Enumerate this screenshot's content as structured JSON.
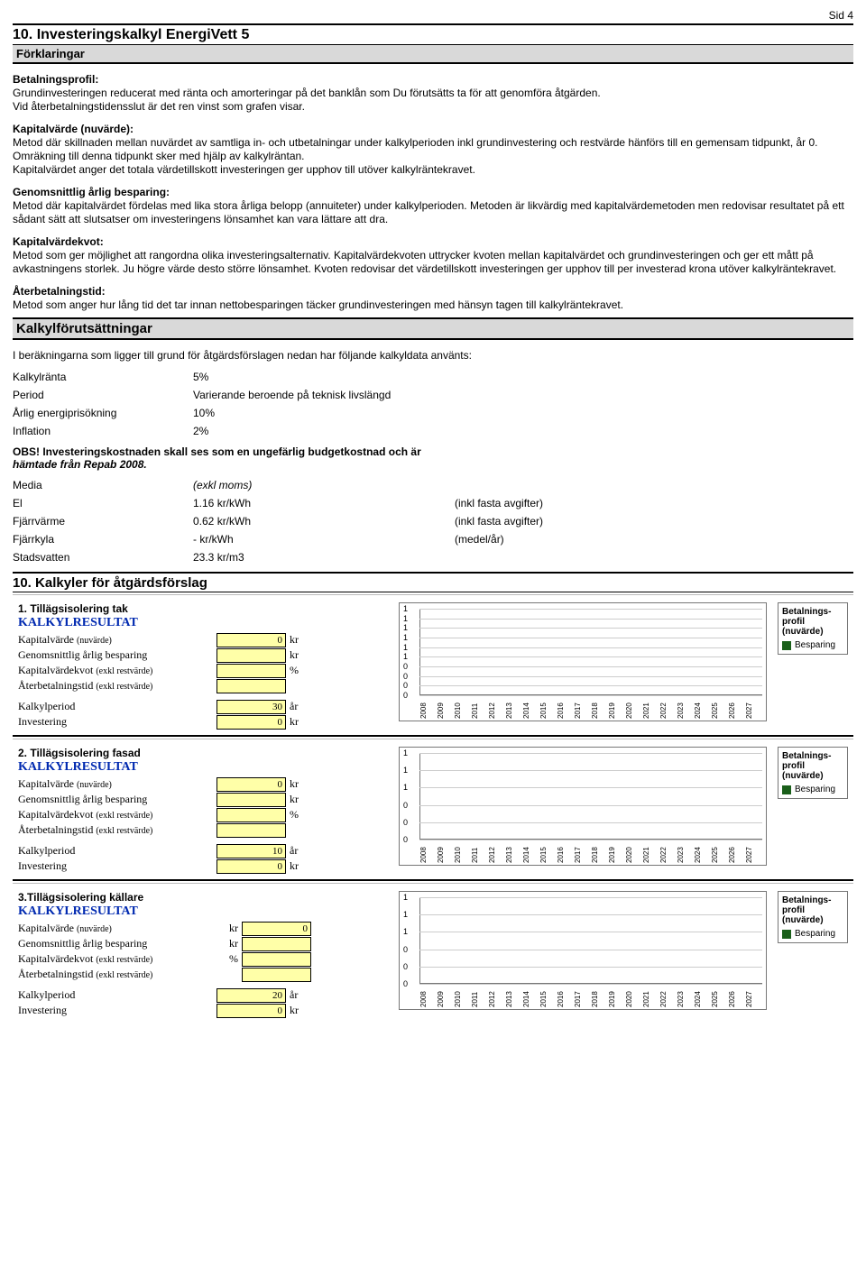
{
  "page_number": "Sid 4",
  "headline": "10. Investeringskalkyl EnergiVett 5",
  "subhead": "Förklaringar",
  "paragraphs": {
    "betalnings_title": "Betalningsprofil:",
    "betalnings_body1": "Grundinvesteringen reducerat med ränta och amorteringar på det banklån som Du förutsätts ta för att genomföra åtgärden.",
    "betalnings_body2": "Vid återbetalningstidensslut är det ren vinst som grafen visar.",
    "kapital_title": "Kapitalvärde (nuvärde):",
    "kapital_body1": "Metod där skillnaden mellan nuvärdet av samtliga in- och utbetalningar under kalkylperioden inkl grundinvestering och restvärde hänförs till en gemensam tidpunkt, år 0. Omräkning till denna tidpunkt sker med hjälp av kalkylräntan.",
    "kapital_body2": "Kapitalvärdet anger det totala värdetillskott investeringen ger upphov till utöver kalkylräntekravet.",
    "genoms_title": "Genomsnittlig årlig besparing:",
    "genoms_body": "Metod där kapitalvärdet fördelas med lika stora årliga belopp (annuiteter) under kalkylperioden. Metoden är likvärdig med kapitalvärdemetoden men redovisar resultatet på ett sådant sätt att slutsatser om investeringens lönsamhet kan vara lättare att dra.",
    "kvot_title": "Kapitalvärdekvot:",
    "kvot_body": "Metod som ger möjlighet att rangordna olika investeringsalternativ. Kapitalvärdekvoten uttrycker kvoten mellan kapitalvärdet och grundinvesteringen och ger ett mått på avkastningens storlek. Ju högre värde desto större lönsamhet. Kvoten redovisar det värdetillskott investeringen ger upphov till per investerad krona utöver kalkylräntekravet.",
    "aterb_title": "Återbetalningstid:",
    "aterb_body": "Metod som anger hur lång tid det tar innan nettobesparingen täcker grundinvesteringen med hänsyn tagen till kalkylräntekravet."
  },
  "kalkforut_title": "Kalkylförutsättningar",
  "kalkforut_intro": "I beräkningarna som ligger till grund för åtgärdsförslagen nedan har följande kalkyldata använts:",
  "kvrows": {
    "kalkylranta_k": "Kalkylränta",
    "kalkylranta_v": "5%",
    "period_k": "Period",
    "period_v": "Varierande beroende på teknisk livslängd",
    "arlig_k": "Årlig energiprisökning",
    "arlig_v": "10%",
    "inflation_k": "Inflation",
    "inflation_v": "2%",
    "obs1": "OBS! Investeringskostnaden skall ses som en ungefärlig budgetkostnad och är",
    "obs2": "hämtade från Repab 2008.",
    "media_k": "Media",
    "media_v": "(exkl moms)",
    "el_k": "El",
    "el_v": "1.16 kr/kWh",
    "el_n": "(inkl fasta avgifter)",
    "fj_k": "Fjärrvärme",
    "fj_v": "0.62 kr/kWh",
    "fj_n": "(inkl fasta avgifter)",
    "fk_k": "Fjärrkyla",
    "fk_v": "-  kr/kWh",
    "fk_n": "(medel/år)",
    "sv_k": "Stadsvatten",
    "sv_v": "23.3 kr/m3"
  },
  "section10_title": "10. Kalkyler för åtgärdsförslag",
  "legend_title": "Betalnings-profil (nuvärde)",
  "legend_item": "Besparing",
  "xyears": [
    "2008",
    "2009",
    "2010",
    "2011",
    "2012",
    "2013",
    "2014",
    "2015",
    "2016",
    "2017",
    "2018",
    "2019",
    "2020",
    "2021",
    "2022",
    "2023",
    "2024",
    "2025",
    "2026",
    "2027"
  ],
  "cards": [
    {
      "title": "1. Tillägsisolering tak",
      "heading": "KALKYLRESULTAT",
      "kapital_lbl": "Kapitalvärde",
      "kapital_sub": "(nuvärde)",
      "kapital_val": "0",
      "kapital_unit": "kr",
      "genoms_lbl": "Genomsnittlig årlig besparing",
      "genoms_val": "",
      "genoms_unit": "kr",
      "kvot_lbl": "Kapitalvärdekvot",
      "kvot_sub": "(exkl restvärde)",
      "kvot_val": "",
      "kvot_unit": "%",
      "ater_lbl": "Återbetalningstid",
      "ater_sub": "(exkl restvärde)",
      "ater_val": "",
      "period_lbl": "Kalkylperiod",
      "period_val": "30",
      "period_unit": "år",
      "invest_lbl": "Investering",
      "invest_val": "0",
      "invest_unit": "kr",
      "yticks": [
        "1",
        "1",
        "1",
        "1",
        "1",
        "1",
        "0",
        "0",
        "0",
        "0"
      ]
    },
    {
      "title": "2. Tillägsisolering fasad",
      "heading": "KALKYLRESULTAT",
      "kapital_lbl": "Kapitalvärde",
      "kapital_sub": "(nuvärde)",
      "kapital_val": "0",
      "kapital_unit": "kr",
      "genoms_lbl": "Genomsnittlig årlig besparing",
      "genoms_val": "",
      "genoms_unit": "kr",
      "kvot_lbl": "Kapitalvärdekvot",
      "kvot_sub": "(exkl restvärde)",
      "kvot_val": "",
      "kvot_unit": "%",
      "ater_lbl": "Återbetalningstid",
      "ater_sub": "(exkl restvärde)",
      "ater_val": "",
      "period_lbl": "Kalkylperiod",
      "period_val": "10",
      "period_unit": "år",
      "invest_lbl": "Investering",
      "invest_val": "0",
      "invest_unit": "kr",
      "yticks": [
        "1",
        "1",
        "1",
        "0",
        "0",
        "0"
      ]
    },
    {
      "title": "3.Tillägsisolering källare",
      "heading": "KALKYLRESULTAT",
      "kapital_lbl": "Kapitalvärde",
      "kapital_sub": "(nuvärde)",
      "kapital_val": "0",
      "kapital_unit": "kr",
      "genoms_lbl": "Genomsnittlig årlig besparing",
      "genoms_val": "",
      "genoms_unit": "kr",
      "kvot_lbl": "Kapitalvärdekvot",
      "kvot_sub": "(exkl restvärde)",
      "kvot_val": "",
      "kvot_unit": "%",
      "ater_lbl": "Återbetalningstid",
      "ater_sub": "(exkl restvärde)",
      "ater_val": "",
      "period_lbl": "Kalkylperiod",
      "period_val": "20",
      "period_unit": "år",
      "invest_lbl": "Investering",
      "invest_val": "0",
      "invest_unit": "kr",
      "yticks": [
        "1",
        "1",
        "1",
        "0",
        "0",
        "0"
      ]
    }
  ],
  "chart_data": [
    {
      "type": "bar",
      "title": "Betalningsprofil (nuvärde) — 1. Tillägsisolering tak",
      "categories": [
        "2008",
        "2009",
        "2010",
        "2011",
        "2012",
        "2013",
        "2014",
        "2015",
        "2016",
        "2017",
        "2018",
        "2019",
        "2020",
        "2021",
        "2022",
        "2023",
        "2024",
        "2025",
        "2026",
        "2027"
      ],
      "series": [
        {
          "name": "Besparing",
          "values": [
            0,
            0,
            0,
            0,
            0,
            0,
            0,
            0,
            0,
            0,
            0,
            0,
            0,
            0,
            0,
            0,
            0,
            0,
            0,
            0
          ]
        }
      ],
      "ylim": [
        0,
        1
      ]
    },
    {
      "type": "bar",
      "title": "Betalningsprofil (nuvärde) — 2. Tillägsisolering fasad",
      "categories": [
        "2008",
        "2009",
        "2010",
        "2011",
        "2012",
        "2013",
        "2014",
        "2015",
        "2016",
        "2017",
        "2018",
        "2019",
        "2020",
        "2021",
        "2022",
        "2023",
        "2024",
        "2025",
        "2026",
        "2027"
      ],
      "series": [
        {
          "name": "Besparing",
          "values": [
            0,
            0,
            0,
            0,
            0,
            0,
            0,
            0,
            0,
            0,
            0,
            0,
            0,
            0,
            0,
            0,
            0,
            0,
            0,
            0
          ]
        }
      ],
      "ylim": [
        0,
        1
      ]
    },
    {
      "type": "bar",
      "title": "Betalningsprofil (nuvärde) — 3. Tillägsisolering källare",
      "categories": [
        "2008",
        "2009",
        "2010",
        "2011",
        "2012",
        "2013",
        "2014",
        "2015",
        "2016",
        "2017",
        "2018",
        "2019",
        "2020",
        "2021",
        "2022",
        "2023",
        "2024",
        "2025",
        "2026",
        "2027"
      ],
      "series": [
        {
          "name": "Besparing",
          "values": [
            0,
            0,
            0,
            0,
            0,
            0,
            0,
            0,
            0,
            0,
            0,
            0,
            0,
            0,
            0,
            0,
            0,
            0,
            0,
            0
          ]
        }
      ],
      "ylim": [
        0,
        1
      ]
    }
  ]
}
